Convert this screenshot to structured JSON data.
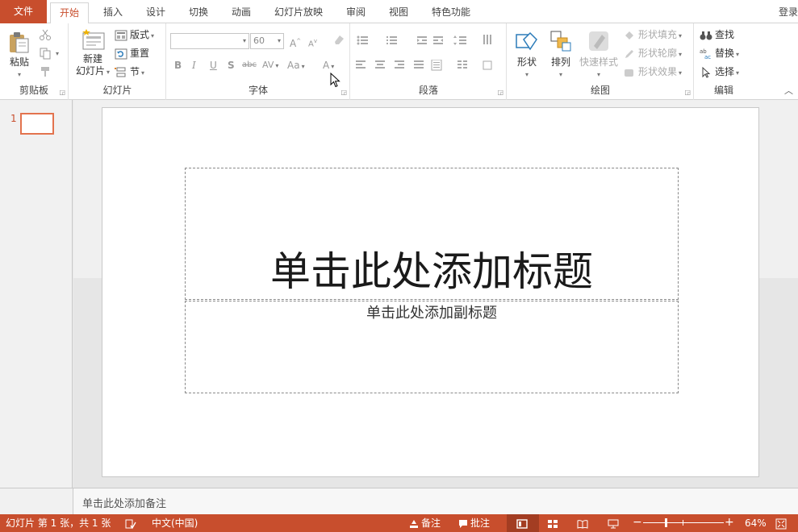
{
  "tabs": {
    "file": "文件",
    "items": [
      "开始",
      "插入",
      "设计",
      "切换",
      "动画",
      "幻灯片放映",
      "审阅",
      "视图",
      "特色功能"
    ],
    "login": "登录"
  },
  "ribbon": {
    "clipboard": {
      "label": "剪贴板",
      "paste": "粘贴"
    },
    "slides": {
      "label": "幻灯片",
      "new_slide_line1": "新建",
      "new_slide_line2": "幻灯片",
      "layout": "版式",
      "reset": "重置",
      "section": "节"
    },
    "font": {
      "label": "字体",
      "font_size": "60"
    },
    "paragraph": {
      "label": "段落"
    },
    "drawing": {
      "label": "绘图",
      "shapes": "形状",
      "arrange": "排列",
      "quick_styles": "快速样式",
      "shape_fill": "形状填充",
      "shape_outline": "形状轮廓",
      "shape_effects": "形状效果"
    },
    "editing": {
      "label": "编辑",
      "find": "查找",
      "replace": "替换",
      "select": "选择"
    }
  },
  "thumbnails": {
    "slide_number": "1"
  },
  "slide": {
    "title_placeholder": "单击此处添加标题",
    "subtitle_placeholder": "单击此处添加副标题"
  },
  "notes": {
    "placeholder": "单击此处添加备注"
  },
  "status": {
    "slide_info": "幻灯片 第 1 张，共 1 张",
    "language": "中文(中国)",
    "notes": "备注",
    "comments": "批注",
    "zoom": "64%"
  },
  "colors": {
    "accent": "#c84e2d",
    "status_active": "#a33d22"
  }
}
